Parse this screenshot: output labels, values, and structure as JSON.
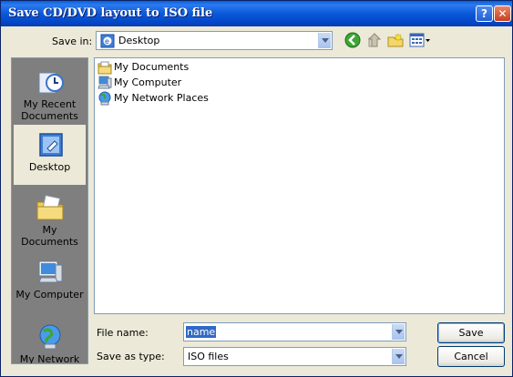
{
  "window": {
    "title": "Save CD/DVD layout to ISO file",
    "help_glyph": "?",
    "close_glyph": "✕"
  },
  "toolbar": {
    "save_in_label": "Save in:",
    "save_in_value": "Desktop"
  },
  "places": [
    {
      "label": "My Recent Documents"
    },
    {
      "label": "Desktop"
    },
    {
      "label": "My Documents"
    },
    {
      "label": "My Computer"
    },
    {
      "label": "My Network"
    }
  ],
  "files": [
    {
      "name": "My Documents"
    },
    {
      "name": "My Computer"
    },
    {
      "name": "My Network Places"
    }
  ],
  "form": {
    "file_name_label": "File name:",
    "file_name_value": "name",
    "save_type_label": "Save as type:",
    "save_type_value": "ISO files"
  },
  "buttons": {
    "save": "Save",
    "cancel": "Cancel"
  }
}
